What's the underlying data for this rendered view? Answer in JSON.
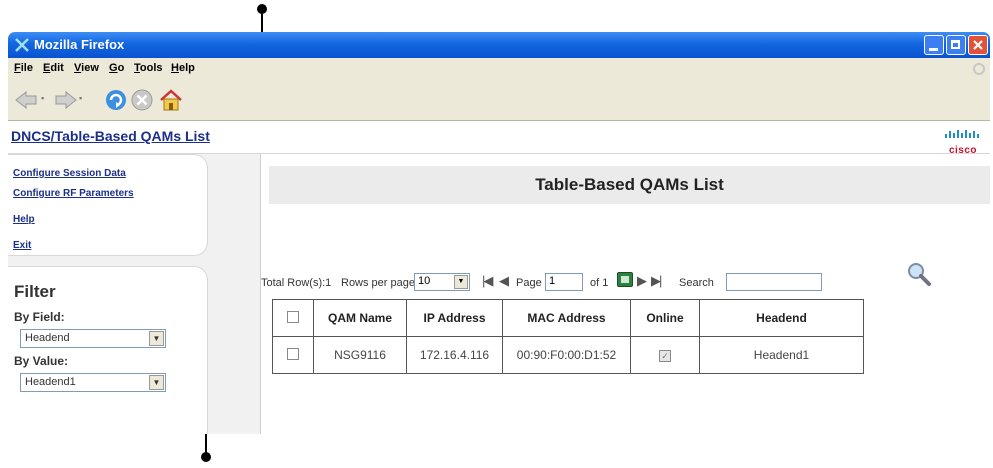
{
  "browser": {
    "title": "Mozilla Firefox",
    "menus": [
      "File",
      "Edit",
      "View",
      "Go",
      "Tools",
      "Help"
    ]
  },
  "page": {
    "breadcrumb": "DNCS/Table-Based QAMs List",
    "brand": "cisco"
  },
  "sidebar": {
    "links": [
      "Configure Session Data",
      "Configure RF Parameters",
      "Help",
      "Exit"
    ],
    "filter": {
      "title": "Filter",
      "by_field_label": "By Field:",
      "by_field_value": "Headend",
      "by_value_label": "By Value:",
      "by_value_value": "Headend1"
    }
  },
  "main": {
    "title": "Table-Based QAMs List",
    "total_rows_label": "Total Row(s):1",
    "rows_per_page_label": "Rows per page:",
    "rows_per_page_value": "10",
    "page_label": "Page",
    "page_value": "1",
    "of_label": "of 1",
    "search_label": "Search",
    "search_value": ""
  },
  "table": {
    "columns": [
      "QAM Name",
      "IP Address",
      "MAC Address",
      "Online",
      "Headend"
    ],
    "rows": [
      {
        "qam_name": "NSG9116",
        "ip": "172.16.4.116",
        "mac": "00:90:F0:00:D1:52",
        "online": true,
        "headend": "Headend1"
      }
    ]
  },
  "colors": {
    "titlebar": "#1466e0",
    "link": "#1b2f8a",
    "cisco": "#c8102e"
  }
}
